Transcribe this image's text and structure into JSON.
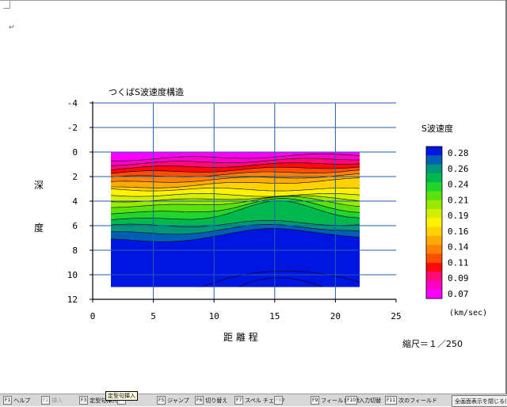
{
  "chart_data": {
    "type": "heatmap",
    "title": "つくばS波速度構造",
    "xlabel": "距 離 程",
    "ylabel_chars": [
      "深",
      "度"
    ],
    "x_ticks": [
      "0",
      "5",
      "10",
      "15",
      "20",
      "25"
    ],
    "y_ticks": [
      "-4",
      "-2",
      "0",
      "2",
      "4",
      "6",
      "8",
      "10",
      "12"
    ],
    "xlim": [
      0,
      25
    ],
    "ylim": [
      -4,
      12
    ],
    "y_inverted": true,
    "data_extent": {
      "x": [
        1.5,
        22
      ],
      "depth": [
        0,
        11
      ]
    },
    "grid": true,
    "legend_title": "S波速度",
    "legend_unit": "(km/sec)",
    "legend_placement": "right",
    "legend": [
      {
        "label": "0.28",
        "color": "#0016e0"
      },
      {
        "label": "0.26",
        "color": "#005eb4"
      },
      {
        "label": "0.26",
        "color": "#00967a"
      },
      {
        "label": "0.24",
        "color": "#00b84e"
      },
      {
        "label": "0.24",
        "color": "#22d42e"
      },
      {
        "label": "0.21",
        "color": "#5ae20e"
      },
      {
        "label": "0.19",
        "color": "#9aea00"
      },
      {
        "label": "0.19",
        "color": "#d4f000"
      },
      {
        "label": "0.16",
        "color": "#fff200"
      },
      {
        "label": "0.14",
        "color": "#ffd200"
      },
      {
        "label": "0.14",
        "color": "#ffaa00"
      },
      {
        "label": "0.11",
        "color": "#ff8200"
      },
      {
        "label": "0.11",
        "color": "#ff4e00"
      },
      {
        "label": "0.09",
        "color": "#ff0a0a"
      },
      {
        "label": "0.09",
        "color": "#ff0a78"
      },
      {
        "label": "0.07",
        "color": "#ff00c8"
      },
      {
        "label": "0.07",
        "color": "#ff00ff"
      }
    ],
    "legend_labels_shown": [
      "0.28",
      "0.26",
      "0.24",
      "0.21",
      "0.19",
      "0.16",
      "0.14",
      "0.11",
      "0.09",
      "0.07"
    ]
  },
  "scale_text": "縮尺＝１／250",
  "return_mark": "↵",
  "tooltip": "定型句挿入",
  "fkeys": [
    {
      "key": "F1",
      "label": "ヘルプ",
      "dim": false
    },
    {
      "key": "F2",
      "label": "挿入",
      "dim": true
    },
    {
      "key": "F3",
      "label": "定型句挿入",
      "dim": false
    },
    {
      "key": "F4",
      "label": "",
      "dim": true
    },
    {
      "key": "F5",
      "label": "ジャンプ",
      "dim": false
    },
    {
      "key": "F6",
      "label": "切り替え",
      "dim": false
    },
    {
      "key": "F7",
      "label": "スペル チェック",
      "dim": false
    },
    {
      "key": "F8",
      "label": "",
      "dim": true
    },
    {
      "key": "F9",
      "label": "フィールド更新",
      "dim": false
    },
    {
      "key": "F10",
      "label": "入力切替",
      "dim": false
    },
    {
      "key": "F11",
      "label": "次のフィールド",
      "dim": false
    },
    {
      "key": "",
      "label": "全画面表示を閉じる(C)",
      "dim": false
    }
  ]
}
